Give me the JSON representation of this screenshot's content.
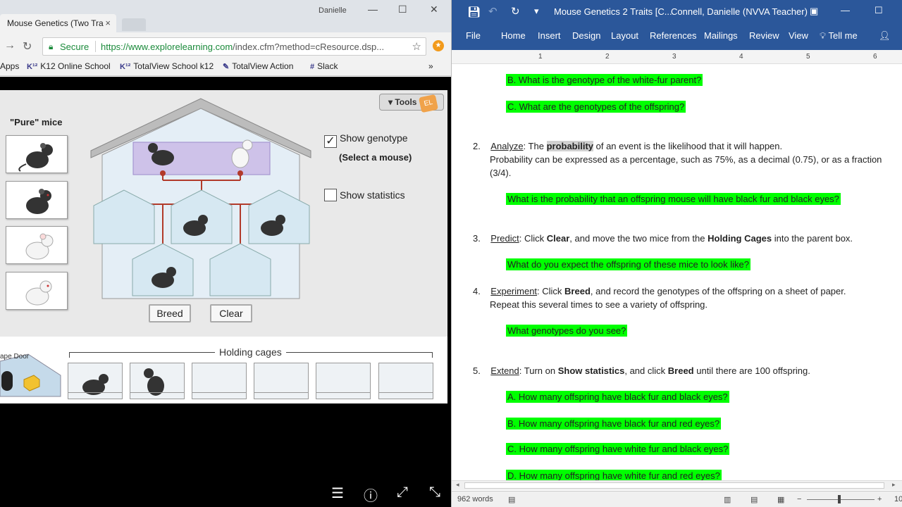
{
  "browser": {
    "tab_title": "Mouse Genetics (Two Tra",
    "tab_close": "×",
    "window_user": "Danielle",
    "secure_label": "Secure",
    "url_host": "https://www.explorelearning.com",
    "url_path": "/index.cfm?method=cResource.dsp...",
    "bookmarks": [
      {
        "icon": "",
        "label": "Apps"
      },
      {
        "icon": "K¹²",
        "label": "K12 Online School"
      },
      {
        "icon": "K¹²",
        "label": "TotalView School k12"
      },
      {
        "icon": "✎",
        "label": "TotalView Action"
      },
      {
        "icon": "#",
        "label": "Slack"
      }
    ],
    "more_bookmarks": "»"
  },
  "gizmo": {
    "tools_label": "Tools",
    "pure_title": "\"Pure\" mice",
    "show_genotype_label": "Show genotype",
    "show_genotype_checked": "✓",
    "select_hint": "(Select a mouse)",
    "show_statistics_label": "Show statistics",
    "breed_label": "Breed",
    "clear_label": "Clear",
    "holding_label": "Holding cages",
    "escape_label": "ape Door",
    "colors": {
      "accent_line": "#b23a2a",
      "cage_glass": "#cfe3ef",
      "roof": "#b8b8b8"
    }
  },
  "word": {
    "doc_title": "Mouse Genetics 2 Traits [C...",
    "user": "Connell, Danielle (NVVA Teacher)",
    "ribbon_tabs": [
      "File",
      "Home",
      "Insert",
      "Design",
      "Layout",
      "References",
      "Mailings",
      "Review",
      "View"
    ],
    "tell_me": "Tell me",
    "ruler_numbers": [
      "1",
      "2",
      "3",
      "4",
      "5",
      "6"
    ],
    "content": {
      "q1b": "B.   What is the genotype of the white-fur parent?",
      "q1c": "C.   What are the genotypes of the offspring?",
      "q2_num": "2.",
      "q2_head": "Analyze",
      "q2_pre": ": The ",
      "q2_term": "probability",
      "q2_post": " of an event is the likelihood that it will happen.",
      "q2_line2": "Probability can be expressed as a percentage, such as 75%, as a decimal (0.75), or as a fraction",
      "q2_line3": "(3/4).",
      "q2_answer": "What is the probability that an offspring mouse will have black fur and black eyes?",
      "q3_num": "3.",
      "q3_head": "Predict",
      "q3_a": ": Click ",
      "q3_b": "Clear",
      "q3_c": ", and move the two mice from the ",
      "q3_d": "Holding Cages",
      "q3_e": " into the parent box.",
      "q3_answer": "What do you expect the offspring of these mice to look like?",
      "q4_num": "4.",
      "q4_head": "Experiment",
      "q4_a": ": Click ",
      "q4_b": "Breed",
      "q4_c": ", and record the genotypes of the offspring on a sheet of paper.",
      "q4_line2": "Repeat this several times to see a variety of offspring.",
      "q4_answer": "What genotypes do you see?",
      "q5_num": "5.",
      "q5_head": "Extend",
      "q5_a": ": Turn on ",
      "q5_b": "Show statistics",
      "q5_c": ", and click ",
      "q5_d": "Breed",
      "q5_e": " until there are 100 offspring.",
      "q5a": "A.   How many offspring have black fur and black eyes?",
      "q5b": "B.   How many offspring have black fur and red eyes?",
      "q5c": "C.   How many offspring have white fur and black eyes?",
      "q5d": "D.   How many offspring have white fur and red eyes?"
    },
    "status": {
      "words": "962 words",
      "zoom": "10"
    },
    "colors": {
      "ribbon": "#2b579a",
      "highlight": "#00ff00"
    }
  }
}
